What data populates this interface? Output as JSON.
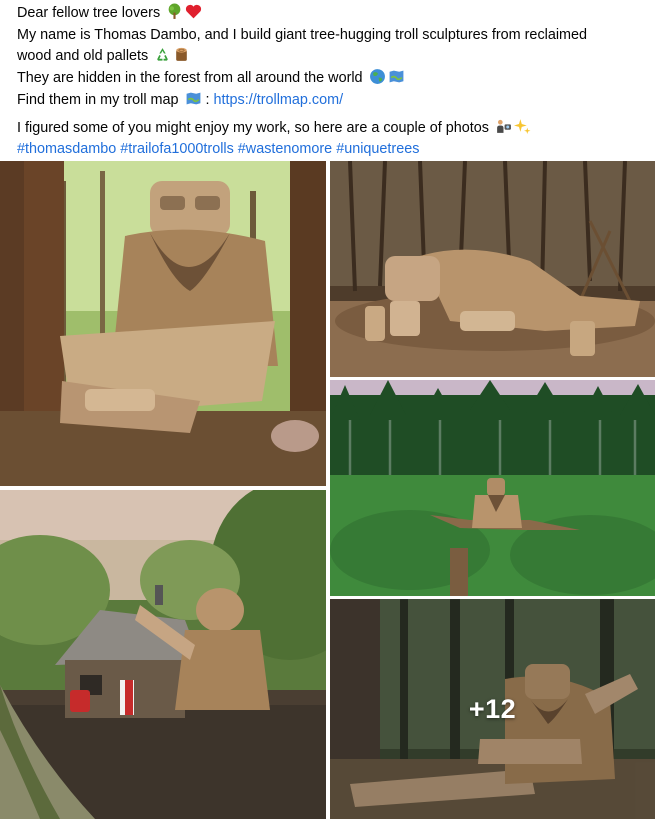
{
  "post": {
    "lines": {
      "greeting": "Dear fellow tree lovers",
      "intro": "My name is Thomas Dambo, and I build giant tree-hugging troll sculptures from reclaimed",
      "intro2": "wood and old pallets",
      "hidden": "They are hidden in the forest from all around the world",
      "map_prefix": "Find them in my troll map",
      "map_sep": " : ",
      "map_link": "https://trollmap.com/",
      "photos": "I figured some of you might enjoy my work, so here are a couple of photos"
    },
    "hashtags": [
      "#thomasdambo",
      "#trailofa1000trolls",
      "#wastenomore",
      "#uniquetrees"
    ]
  },
  "gallery": {
    "more_count": "+12",
    "photos": [
      "troll sitting between trees",
      "troll lying on forest floor",
      "troll in green forest clearing",
      "troll beside wooden house",
      "troll reclining in forest"
    ]
  },
  "icons": [
    "tree-icon",
    "red-heart-icon",
    "recycle-icon",
    "wood-log-icon",
    "globe-icon",
    "map-icon",
    "map-icon",
    "camera-person-icon",
    "sparkles-icon"
  ],
  "colors": {
    "link": "#216fdb",
    "text": "#050505"
  }
}
